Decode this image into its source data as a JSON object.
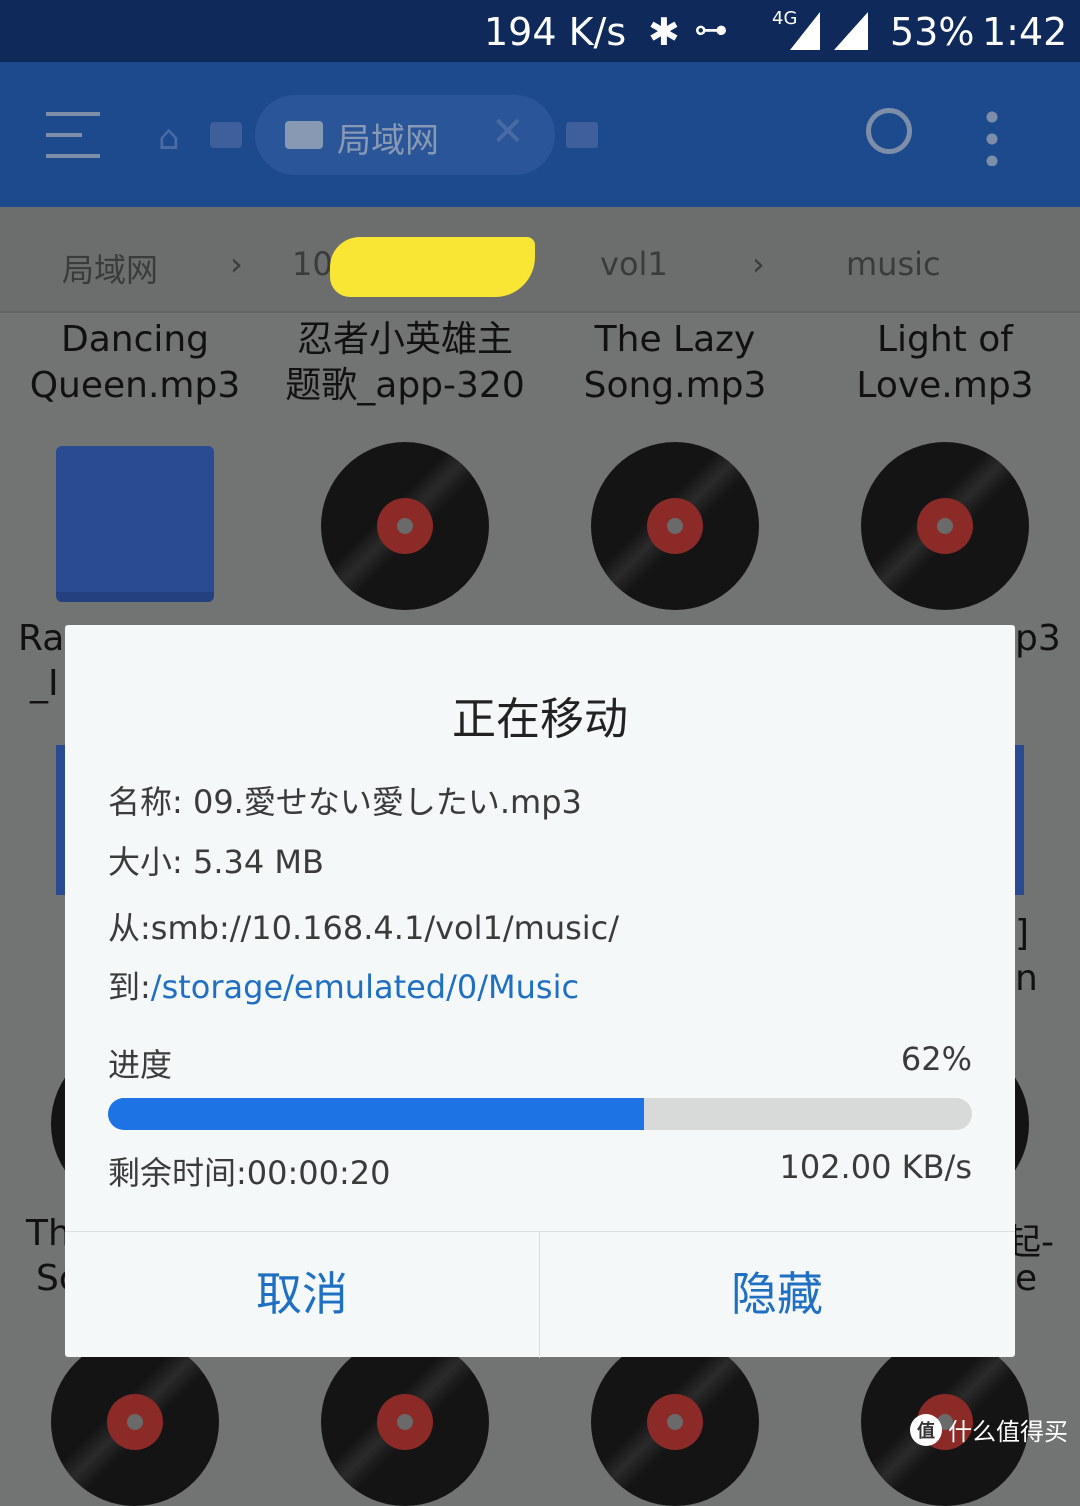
{
  "status_bar": {
    "speed": "194 K/s",
    "network": "4G",
    "battery": "53%",
    "time": "1:42",
    "icons": [
      "bluetooth-icon",
      "vpn-key-icon",
      "signal-icon"
    ]
  },
  "toolbar": {
    "tab_label": "局域网",
    "icons": [
      "menu-icon",
      "home-icon",
      "network-icon",
      "close-icon",
      "sdcard-icon",
      "search-icon",
      "more-icon"
    ]
  },
  "breadcrumb": [
    "局域网",
    "10",
    "vol1",
    "music"
  ],
  "files": {
    "row1": [
      "Dancing\nQueen.mp3",
      "忍者小英雄主\n题歌_app-320",
      "The Lazy\nSong.mp3",
      "Light of\nLove.mp3"
    ],
    "fragments": [
      "Ra",
      "_I",
      "p3",
      "]",
      "n",
      "Th",
      "Sc",
      "起-",
      "e"
    ]
  },
  "dialog": {
    "title": "正在移动",
    "name": "名称: 09.愛せない愛したい.mp3",
    "size": "大小: 5.34 MB",
    "from": "从:smb://10.168.4.1/vol1/music/",
    "to_label": "到:",
    "to_path": "/storage/emulated/0/Music",
    "progress_label": "进度",
    "progress_text": "62%",
    "progress_value": 62,
    "remaining": "剩余时间:00:00:20",
    "speed": "102.00 KB/s",
    "cancel": "取消",
    "hide": "隐藏"
  },
  "watermark": {
    "text": "什么值得买",
    "logo": "值"
  },
  "colors": {
    "accent": "#1d73e3",
    "link": "#1f6fc3",
    "toolbar": "#1d4a8d"
  }
}
